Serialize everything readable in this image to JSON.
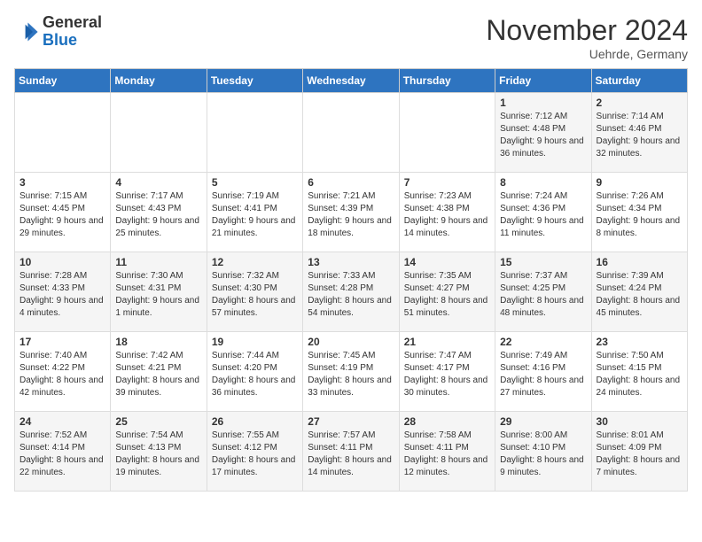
{
  "logo": {
    "general": "General",
    "blue": "Blue"
  },
  "header": {
    "month": "November 2024",
    "location": "Uehrde, Germany"
  },
  "weekdays": [
    "Sunday",
    "Monday",
    "Tuesday",
    "Wednesday",
    "Thursday",
    "Friday",
    "Saturday"
  ],
  "weeks": [
    [
      {
        "day": "",
        "info": ""
      },
      {
        "day": "",
        "info": ""
      },
      {
        "day": "",
        "info": ""
      },
      {
        "day": "",
        "info": ""
      },
      {
        "day": "",
        "info": ""
      },
      {
        "day": "1",
        "info": "Sunrise: 7:12 AM\nSunset: 4:48 PM\nDaylight: 9 hours and 36 minutes."
      },
      {
        "day": "2",
        "info": "Sunrise: 7:14 AM\nSunset: 4:46 PM\nDaylight: 9 hours and 32 minutes."
      }
    ],
    [
      {
        "day": "3",
        "info": "Sunrise: 7:15 AM\nSunset: 4:45 PM\nDaylight: 9 hours and 29 minutes."
      },
      {
        "day": "4",
        "info": "Sunrise: 7:17 AM\nSunset: 4:43 PM\nDaylight: 9 hours and 25 minutes."
      },
      {
        "day": "5",
        "info": "Sunrise: 7:19 AM\nSunset: 4:41 PM\nDaylight: 9 hours and 21 minutes."
      },
      {
        "day": "6",
        "info": "Sunrise: 7:21 AM\nSunset: 4:39 PM\nDaylight: 9 hours and 18 minutes."
      },
      {
        "day": "7",
        "info": "Sunrise: 7:23 AM\nSunset: 4:38 PM\nDaylight: 9 hours and 14 minutes."
      },
      {
        "day": "8",
        "info": "Sunrise: 7:24 AM\nSunset: 4:36 PM\nDaylight: 9 hours and 11 minutes."
      },
      {
        "day": "9",
        "info": "Sunrise: 7:26 AM\nSunset: 4:34 PM\nDaylight: 9 hours and 8 minutes."
      }
    ],
    [
      {
        "day": "10",
        "info": "Sunrise: 7:28 AM\nSunset: 4:33 PM\nDaylight: 9 hours and 4 minutes."
      },
      {
        "day": "11",
        "info": "Sunrise: 7:30 AM\nSunset: 4:31 PM\nDaylight: 9 hours and 1 minute."
      },
      {
        "day": "12",
        "info": "Sunrise: 7:32 AM\nSunset: 4:30 PM\nDaylight: 8 hours and 57 minutes."
      },
      {
        "day": "13",
        "info": "Sunrise: 7:33 AM\nSunset: 4:28 PM\nDaylight: 8 hours and 54 minutes."
      },
      {
        "day": "14",
        "info": "Sunrise: 7:35 AM\nSunset: 4:27 PM\nDaylight: 8 hours and 51 minutes."
      },
      {
        "day": "15",
        "info": "Sunrise: 7:37 AM\nSunset: 4:25 PM\nDaylight: 8 hours and 48 minutes."
      },
      {
        "day": "16",
        "info": "Sunrise: 7:39 AM\nSunset: 4:24 PM\nDaylight: 8 hours and 45 minutes."
      }
    ],
    [
      {
        "day": "17",
        "info": "Sunrise: 7:40 AM\nSunset: 4:22 PM\nDaylight: 8 hours and 42 minutes."
      },
      {
        "day": "18",
        "info": "Sunrise: 7:42 AM\nSunset: 4:21 PM\nDaylight: 8 hours and 39 minutes."
      },
      {
        "day": "19",
        "info": "Sunrise: 7:44 AM\nSunset: 4:20 PM\nDaylight: 8 hours and 36 minutes."
      },
      {
        "day": "20",
        "info": "Sunrise: 7:45 AM\nSunset: 4:19 PM\nDaylight: 8 hours and 33 minutes."
      },
      {
        "day": "21",
        "info": "Sunrise: 7:47 AM\nSunset: 4:17 PM\nDaylight: 8 hours and 30 minutes."
      },
      {
        "day": "22",
        "info": "Sunrise: 7:49 AM\nSunset: 4:16 PM\nDaylight: 8 hours and 27 minutes."
      },
      {
        "day": "23",
        "info": "Sunrise: 7:50 AM\nSunset: 4:15 PM\nDaylight: 8 hours and 24 minutes."
      }
    ],
    [
      {
        "day": "24",
        "info": "Sunrise: 7:52 AM\nSunset: 4:14 PM\nDaylight: 8 hours and 22 minutes."
      },
      {
        "day": "25",
        "info": "Sunrise: 7:54 AM\nSunset: 4:13 PM\nDaylight: 8 hours and 19 minutes."
      },
      {
        "day": "26",
        "info": "Sunrise: 7:55 AM\nSunset: 4:12 PM\nDaylight: 8 hours and 17 minutes."
      },
      {
        "day": "27",
        "info": "Sunrise: 7:57 AM\nSunset: 4:11 PM\nDaylight: 8 hours and 14 minutes."
      },
      {
        "day": "28",
        "info": "Sunrise: 7:58 AM\nSunset: 4:11 PM\nDaylight: 8 hours and 12 minutes."
      },
      {
        "day": "29",
        "info": "Sunrise: 8:00 AM\nSunset: 4:10 PM\nDaylight: 8 hours and 9 minutes."
      },
      {
        "day": "30",
        "info": "Sunrise: 8:01 AM\nSunset: 4:09 PM\nDaylight: 8 hours and 7 minutes."
      }
    ]
  ]
}
